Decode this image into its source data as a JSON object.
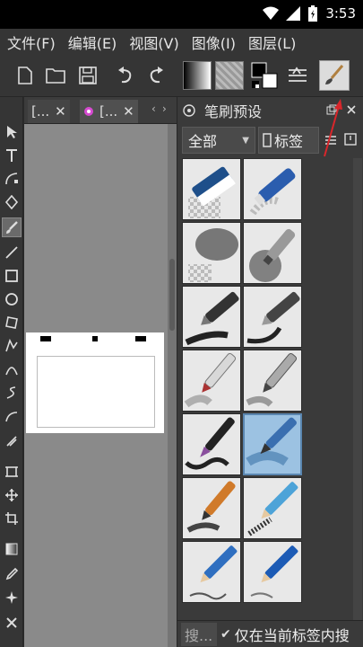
{
  "status": {
    "time": "3:53"
  },
  "menu": [
    {
      "label": "文件(F)"
    },
    {
      "label": "编辑(E)"
    },
    {
      "label": "视图(V)"
    },
    {
      "label": "图像(I)"
    },
    {
      "label": "图层(L)"
    }
  ],
  "tabs": [
    {
      "label": "[..."
    },
    {
      "label": "[..."
    }
  ],
  "panel": {
    "title": "笔刷预设",
    "filter_value": "全部",
    "tag_label": "标签",
    "search_placeholder": "搜...",
    "only_current_tag_label": "仅在当前标签内搜"
  },
  "colors": {
    "accent_red": "#d9262b",
    "selected_brush": "#9cc2e2"
  }
}
